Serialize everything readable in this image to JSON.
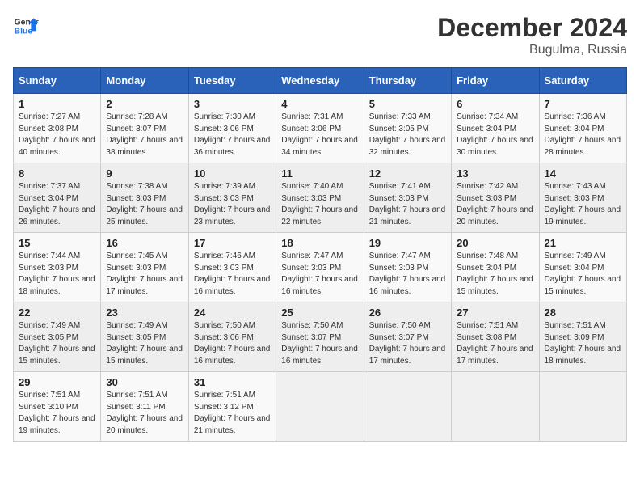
{
  "header": {
    "logo_line1": "General",
    "logo_line2": "Blue",
    "month": "December 2024",
    "location": "Bugulma, Russia"
  },
  "weekdays": [
    "Sunday",
    "Monday",
    "Tuesday",
    "Wednesday",
    "Thursday",
    "Friday",
    "Saturday"
  ],
  "weeks": [
    [
      {
        "day": "1",
        "sunrise": "Sunrise: 7:27 AM",
        "sunset": "Sunset: 3:08 PM",
        "daylight": "Daylight: 7 hours and 40 minutes."
      },
      {
        "day": "2",
        "sunrise": "Sunrise: 7:28 AM",
        "sunset": "Sunset: 3:07 PM",
        "daylight": "Daylight: 7 hours and 38 minutes."
      },
      {
        "day": "3",
        "sunrise": "Sunrise: 7:30 AM",
        "sunset": "Sunset: 3:06 PM",
        "daylight": "Daylight: 7 hours and 36 minutes."
      },
      {
        "day": "4",
        "sunrise": "Sunrise: 7:31 AM",
        "sunset": "Sunset: 3:06 PM",
        "daylight": "Daylight: 7 hours and 34 minutes."
      },
      {
        "day": "5",
        "sunrise": "Sunrise: 7:33 AM",
        "sunset": "Sunset: 3:05 PM",
        "daylight": "Daylight: 7 hours and 32 minutes."
      },
      {
        "day": "6",
        "sunrise": "Sunrise: 7:34 AM",
        "sunset": "Sunset: 3:04 PM",
        "daylight": "Daylight: 7 hours and 30 minutes."
      },
      {
        "day": "7",
        "sunrise": "Sunrise: 7:36 AM",
        "sunset": "Sunset: 3:04 PM",
        "daylight": "Daylight: 7 hours and 28 minutes."
      }
    ],
    [
      {
        "day": "8",
        "sunrise": "Sunrise: 7:37 AM",
        "sunset": "Sunset: 3:04 PM",
        "daylight": "Daylight: 7 hours and 26 minutes."
      },
      {
        "day": "9",
        "sunrise": "Sunrise: 7:38 AM",
        "sunset": "Sunset: 3:03 PM",
        "daylight": "Daylight: 7 hours and 25 minutes."
      },
      {
        "day": "10",
        "sunrise": "Sunrise: 7:39 AM",
        "sunset": "Sunset: 3:03 PM",
        "daylight": "Daylight: 7 hours and 23 minutes."
      },
      {
        "day": "11",
        "sunrise": "Sunrise: 7:40 AM",
        "sunset": "Sunset: 3:03 PM",
        "daylight": "Daylight: 7 hours and 22 minutes."
      },
      {
        "day": "12",
        "sunrise": "Sunrise: 7:41 AM",
        "sunset": "Sunset: 3:03 PM",
        "daylight": "Daylight: 7 hours and 21 minutes."
      },
      {
        "day": "13",
        "sunrise": "Sunrise: 7:42 AM",
        "sunset": "Sunset: 3:03 PM",
        "daylight": "Daylight: 7 hours and 20 minutes."
      },
      {
        "day": "14",
        "sunrise": "Sunrise: 7:43 AM",
        "sunset": "Sunset: 3:03 PM",
        "daylight": "Daylight: 7 hours and 19 minutes."
      }
    ],
    [
      {
        "day": "15",
        "sunrise": "Sunrise: 7:44 AM",
        "sunset": "Sunset: 3:03 PM",
        "daylight": "Daylight: 7 hours and 18 minutes."
      },
      {
        "day": "16",
        "sunrise": "Sunrise: 7:45 AM",
        "sunset": "Sunset: 3:03 PM",
        "daylight": "Daylight: 7 hours and 17 minutes."
      },
      {
        "day": "17",
        "sunrise": "Sunrise: 7:46 AM",
        "sunset": "Sunset: 3:03 PM",
        "daylight": "Daylight: 7 hours and 16 minutes."
      },
      {
        "day": "18",
        "sunrise": "Sunrise: 7:47 AM",
        "sunset": "Sunset: 3:03 PM",
        "daylight": "Daylight: 7 hours and 16 minutes."
      },
      {
        "day": "19",
        "sunrise": "Sunrise: 7:47 AM",
        "sunset": "Sunset: 3:03 PM",
        "daylight": "Daylight: 7 hours and 16 minutes."
      },
      {
        "day": "20",
        "sunrise": "Sunrise: 7:48 AM",
        "sunset": "Sunset: 3:04 PM",
        "daylight": "Daylight: 7 hours and 15 minutes."
      },
      {
        "day": "21",
        "sunrise": "Sunrise: 7:49 AM",
        "sunset": "Sunset: 3:04 PM",
        "daylight": "Daylight: 7 hours and 15 minutes."
      }
    ],
    [
      {
        "day": "22",
        "sunrise": "Sunrise: 7:49 AM",
        "sunset": "Sunset: 3:05 PM",
        "daylight": "Daylight: 7 hours and 15 minutes."
      },
      {
        "day": "23",
        "sunrise": "Sunrise: 7:49 AM",
        "sunset": "Sunset: 3:05 PM",
        "daylight": "Daylight: 7 hours and 15 minutes."
      },
      {
        "day": "24",
        "sunrise": "Sunrise: 7:50 AM",
        "sunset": "Sunset: 3:06 PM",
        "daylight": "Daylight: 7 hours and 16 minutes."
      },
      {
        "day": "25",
        "sunrise": "Sunrise: 7:50 AM",
        "sunset": "Sunset: 3:07 PM",
        "daylight": "Daylight: 7 hours and 16 minutes."
      },
      {
        "day": "26",
        "sunrise": "Sunrise: 7:50 AM",
        "sunset": "Sunset: 3:07 PM",
        "daylight": "Daylight: 7 hours and 17 minutes."
      },
      {
        "day": "27",
        "sunrise": "Sunrise: 7:51 AM",
        "sunset": "Sunset: 3:08 PM",
        "daylight": "Daylight: 7 hours and 17 minutes."
      },
      {
        "day": "28",
        "sunrise": "Sunrise: 7:51 AM",
        "sunset": "Sunset: 3:09 PM",
        "daylight": "Daylight: 7 hours and 18 minutes."
      }
    ],
    [
      {
        "day": "29",
        "sunrise": "Sunrise: 7:51 AM",
        "sunset": "Sunset: 3:10 PM",
        "daylight": "Daylight: 7 hours and 19 minutes."
      },
      {
        "day": "30",
        "sunrise": "Sunrise: 7:51 AM",
        "sunset": "Sunset: 3:11 PM",
        "daylight": "Daylight: 7 hours and 20 minutes."
      },
      {
        "day": "31",
        "sunrise": "Sunrise: 7:51 AM",
        "sunset": "Sunset: 3:12 PM",
        "daylight": "Daylight: 7 hours and 21 minutes."
      },
      null,
      null,
      null,
      null
    ]
  ]
}
